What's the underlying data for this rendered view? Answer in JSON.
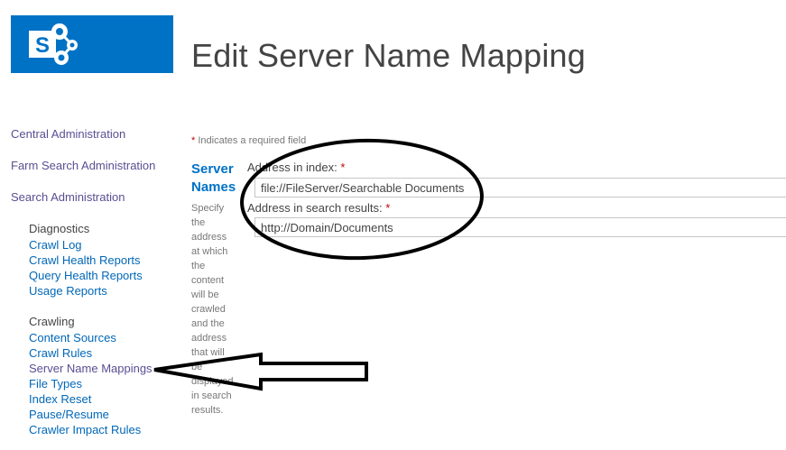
{
  "header": {
    "title": "Edit Server Name Mapping",
    "logo_icon": "sharepoint-logo-icon",
    "logo_letter": "S",
    "brand_color": "#0072c6"
  },
  "nav": {
    "top_links": [
      "Central Administration",
      "Farm Search Administration",
      "Search Administration"
    ],
    "groups": [
      {
        "heading": "Diagnostics",
        "items": [
          "Crawl Log",
          "Crawl Health Reports",
          "Query Health Reports",
          "Usage Reports"
        ]
      },
      {
        "heading": "Crawling",
        "items": [
          "Content Sources",
          "Crawl Rules",
          "Server Name Mappings",
          "File Types",
          "Index Reset",
          "Pause/Resume",
          "Crawler Impact Rules"
        ]
      }
    ]
  },
  "form": {
    "required_star": "*",
    "required_text": " Indicates a required field",
    "section_title": "Server Names",
    "section_description": "Specify the address at which the content will be crawled and the address that will be displayed in search results.",
    "fields": [
      {
        "label": "Address in index:",
        "star": "*",
        "value": "file://FileServer/Searchable Documents"
      },
      {
        "label": "Address in search results:",
        "star": "*",
        "value": "http://Domain/Documents"
      }
    ]
  },
  "annotations": {
    "ellipse_icon": "highlight-ellipse",
    "arrow_icon": "pointer-arrow-icon"
  }
}
